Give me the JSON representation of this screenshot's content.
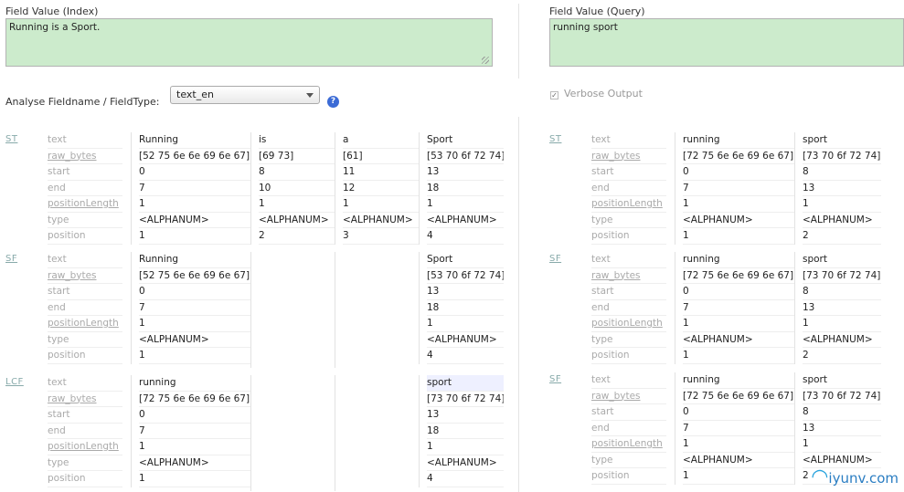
{
  "index": {
    "label": "Field Value (Index)",
    "value": "Running is a Sport."
  },
  "query": {
    "label": "Field Value (Query)",
    "value": "running sport"
  },
  "analyse": {
    "label": "Analyse Fieldname / FieldType:",
    "selected": "text_en",
    "help": "?"
  },
  "verbose": {
    "label": "Verbose Output",
    "check": "✓"
  },
  "field_names": [
    "text",
    "raw_bytes",
    "start",
    "end",
    "positionLength",
    "type",
    "position"
  ],
  "left": {
    "ST": {
      "name": "ST",
      "tokens": [
        [
          "Running",
          "[52 75 6e 6e 69 6e 67]",
          "0",
          "7",
          "1",
          "<ALPHANUM>",
          "1"
        ],
        [
          "is",
          "[69 73]",
          "8",
          "10",
          "1",
          "<ALPHANUM>",
          "2"
        ],
        [
          "a",
          "[61]",
          "11",
          "12",
          "1",
          "<ALPHANUM>",
          "3"
        ],
        [
          "Sport",
          "[53 70 6f 72 74]",
          "13",
          "18",
          "1",
          "<ALPHANUM>",
          "4"
        ]
      ]
    },
    "SF": {
      "name": "SF",
      "tokens": [
        [
          "Running",
          "[52 75 6e 6e 69 6e 67]",
          "0",
          "7",
          "1",
          "<ALPHANUM>",
          "1"
        ],
        [
          "Sport",
          "[53 70 6f 72 74]",
          "13",
          "18",
          "1",
          "<ALPHANUM>",
          "4"
        ]
      ]
    },
    "LCF": {
      "name": "LCF",
      "tokens": [
        [
          "running",
          "[72 75 6e 6e 69 6e 67]",
          "0",
          "7",
          "1",
          "<ALPHANUM>",
          "1"
        ],
        [
          "sport",
          "[73 70 6f 72 74]",
          "13",
          "18",
          "1",
          "<ALPHANUM>",
          "4"
        ]
      ]
    }
  },
  "right": {
    "ST": {
      "name": "ST",
      "tokens": [
        [
          "running",
          "[72 75 6e 6e 69 6e 67]",
          "0",
          "7",
          "1",
          "<ALPHANUM>",
          "1"
        ],
        [
          "sport",
          "[73 70 6f 72 74]",
          "8",
          "13",
          "1",
          "<ALPHANUM>",
          "2"
        ]
      ]
    },
    "SF1": {
      "name": "SF",
      "tokens": [
        [
          "running",
          "[72 75 6e 6e 69 6e 67]",
          "0",
          "7",
          "1",
          "<ALPHANUM>",
          "1"
        ],
        [
          "sport",
          "[73 70 6f 72 74]",
          "8",
          "13",
          "1",
          "<ALPHANUM>",
          "2"
        ]
      ]
    },
    "SF2": {
      "name": "SF",
      "tokens": [
        [
          "running",
          "[72 75 6e 6e 69 6e 67]",
          "0",
          "7",
          "1",
          "<ALPHANUM>",
          "1"
        ],
        [
          "sport",
          "[73 70 6f 72 74]",
          "8",
          "13",
          "1",
          "<ALPHANUM>",
          "2"
        ]
      ]
    }
  },
  "watermark": "iyunv.com"
}
